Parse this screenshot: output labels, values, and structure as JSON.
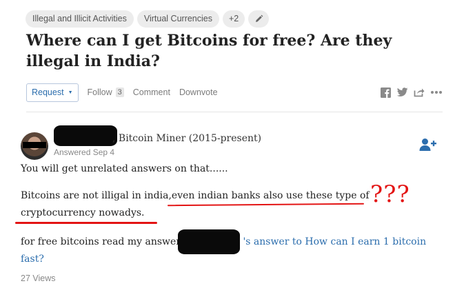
{
  "topics": {
    "items": [
      "Illegal and Illicit Activities",
      "Virtual Currencies"
    ],
    "more_count": "+2",
    "edit_icon": "pencil-icon"
  },
  "question": {
    "title": "Where can I get Bitcoins for free? Are they illegal in India?"
  },
  "actions": {
    "request_label": "Request",
    "follow_label": "Follow",
    "follow_count": "3",
    "comment_label": "Comment",
    "downvote_label": "Downvote",
    "share_icons": [
      "facebook-icon",
      "twitter-icon",
      "share-icon",
      "more-icon"
    ]
  },
  "answer": {
    "author_credential": ", Bitcoin Miner (2015-present)",
    "answered_date": "Answered Sep 4",
    "para1": "You will get unrelated answers on that......",
    "para2": "Bitcoins are not illigal in india,even indian banks also use these type of cryptocurrency nowadys.",
    "para3_prefix": "for free bitcoins read my answer ",
    "para3_link": "'s answer to How can I earn 1 bitcoin fast?",
    "annotation": "???",
    "views": "27 Views",
    "accent_color": "#2b6dad",
    "annotation_color": "#e31414"
  }
}
